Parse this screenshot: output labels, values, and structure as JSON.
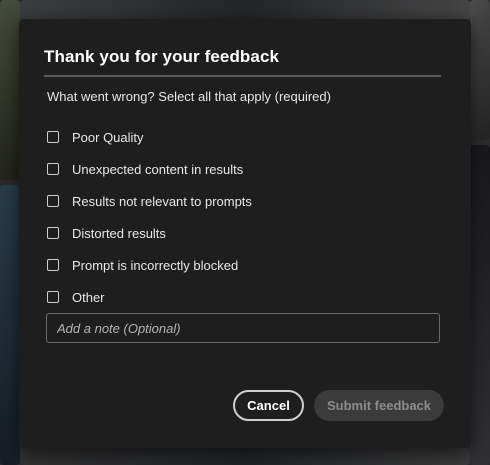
{
  "dialog": {
    "title": "Thank you for your feedback",
    "prompt": "What went wrong? Select all that apply (required)",
    "options": [
      {
        "label": "Poor Quality",
        "checked": false
      },
      {
        "label": "Unexpected content in results",
        "checked": false
      },
      {
        "label": "Results not relevant to prompts",
        "checked": false
      },
      {
        "label": "Distorted results",
        "checked": false
      },
      {
        "label": "Prompt is incorrectly blocked",
        "checked": false
      },
      {
        "label": "Other",
        "checked": false
      }
    ],
    "note": {
      "value": "",
      "placeholder": "Add a note (Optional)"
    },
    "buttons": {
      "cancel_label": "Cancel",
      "submit_label": "Submit feedback",
      "submit_enabled": false
    }
  },
  "colors": {
    "dialog_bg": "#1e1e1e",
    "text_primary": "#ffffff",
    "submit_disabled_bg": "#3b3b3b",
    "submit_disabled_text": "#8c8c8c"
  }
}
